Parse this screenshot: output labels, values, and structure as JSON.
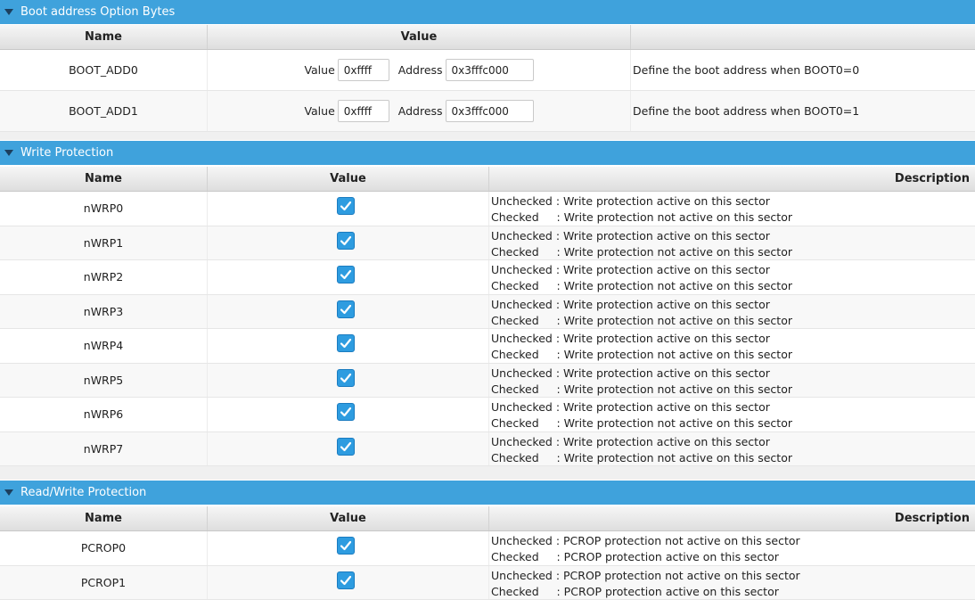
{
  "boot": {
    "header": "Boot address Option Bytes",
    "col_name": "Name",
    "col_value": "Value",
    "col_desc": "",
    "value_label": "Value",
    "address_label": "Address",
    "rows": [
      {
        "name": "BOOT_ADD0",
        "value": "0xffff",
        "address": "0x3fffc000",
        "desc": "Define the boot address when BOOT0=0"
      },
      {
        "name": "BOOT_ADD1",
        "value": "0xffff",
        "address": "0x3fffc000",
        "desc": "Define the boot address when BOOT0=1"
      }
    ]
  },
  "wp": {
    "header": "Write Protection",
    "col_name": "Name",
    "col_value": "Value",
    "col_desc": "Description",
    "desc_line1": "Unchecked : Write protection active on this sector",
    "desc_line2": "Checked     : Write protection not active on this sector",
    "rows": [
      {
        "name": "nWRP0",
        "checked": true
      },
      {
        "name": "nWRP1",
        "checked": true
      },
      {
        "name": "nWRP2",
        "checked": true
      },
      {
        "name": "nWRP3",
        "checked": true
      },
      {
        "name": "nWRP4",
        "checked": true
      },
      {
        "name": "nWRP5",
        "checked": true
      },
      {
        "name": "nWRP6",
        "checked": true
      },
      {
        "name": "nWRP7",
        "checked": true
      }
    ]
  },
  "rwp": {
    "header": "Read/Write Protection",
    "col_name": "Name",
    "col_value": "Value",
    "col_desc": "Description",
    "desc_line1": "Unchecked : PCROP protection not active on this sector",
    "desc_line2": "Checked     : PCROP protection active on this sector",
    "rows": [
      {
        "name": "PCROP0",
        "checked": true
      },
      {
        "name": "PCROP1",
        "checked": true
      }
    ]
  },
  "colors": {
    "header_bg": "#3fa2dc",
    "checkbox": "#2e9ce0"
  },
  "icons": {
    "collapse": "triangle-down-icon",
    "check": "checkmark-icon"
  }
}
